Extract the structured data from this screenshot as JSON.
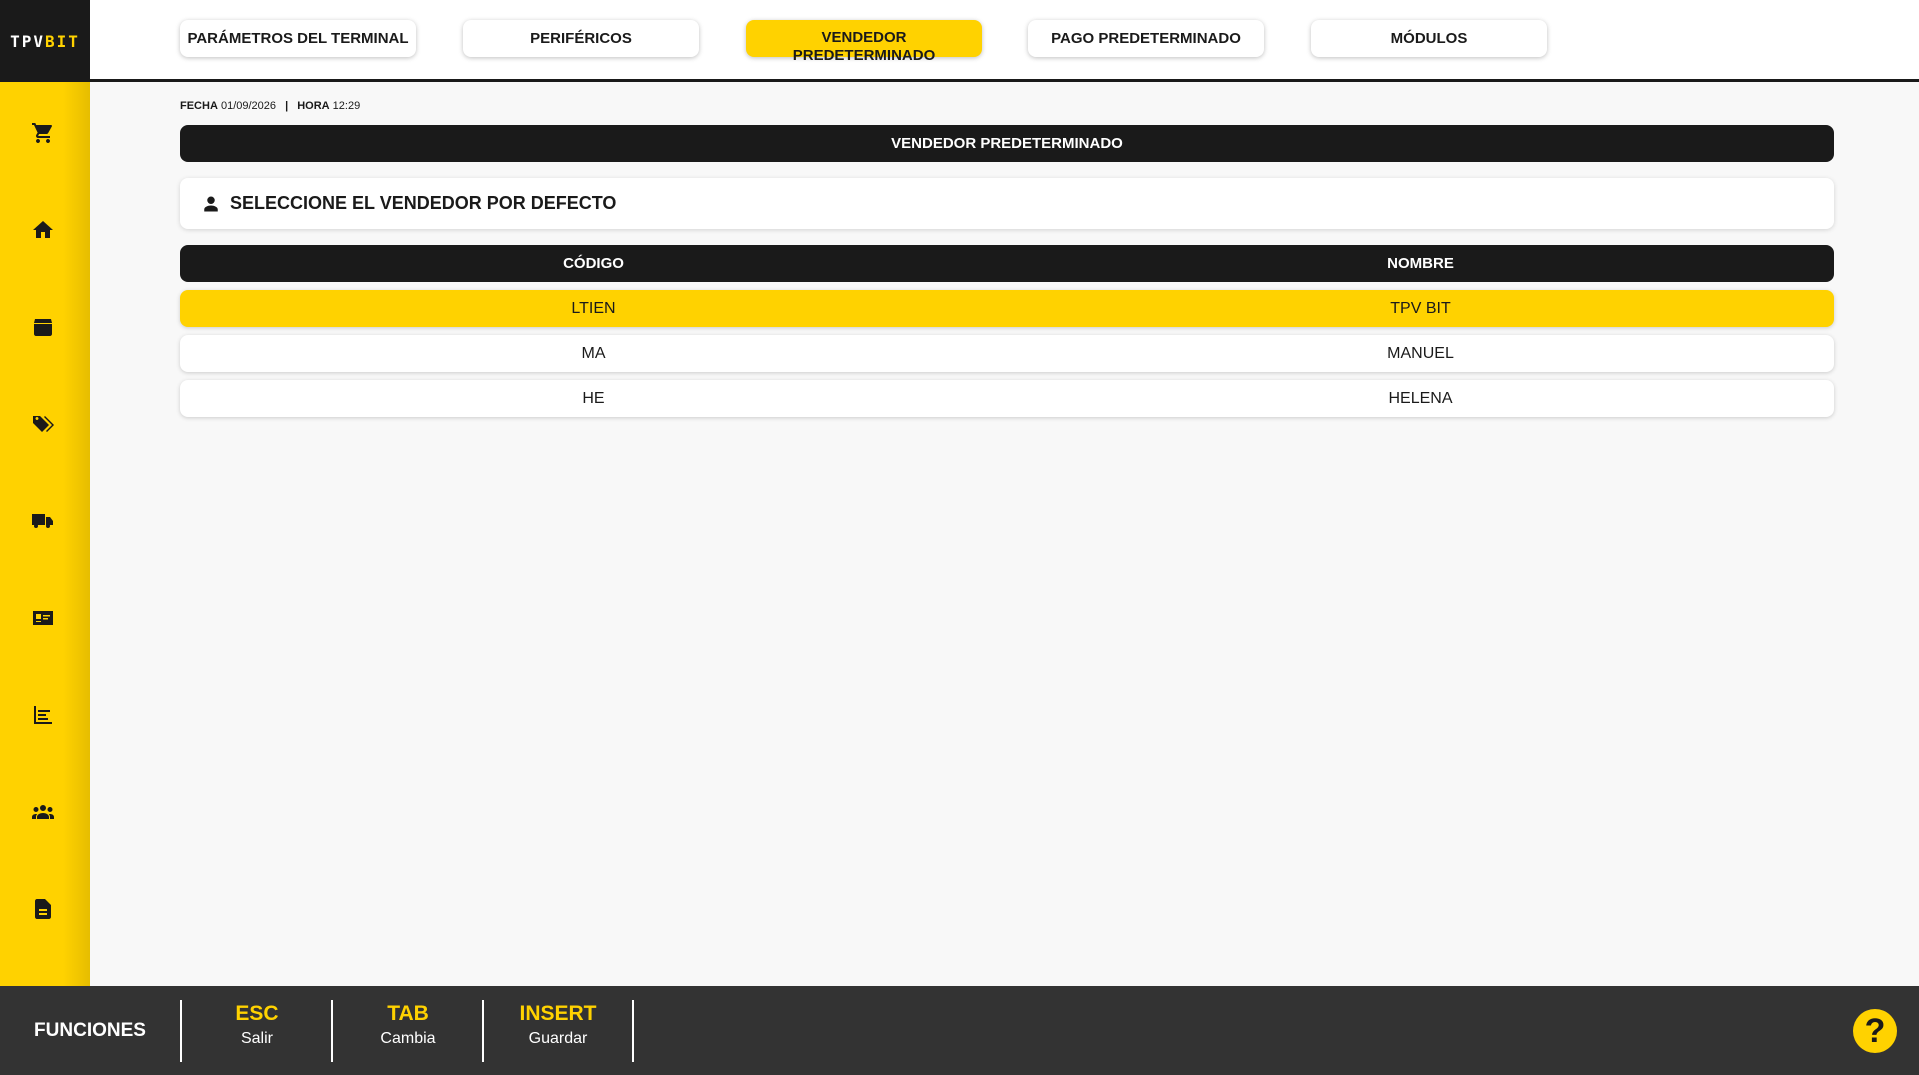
{
  "app": {
    "logo_main": "TPV",
    "logo_accent": "BIT"
  },
  "tabs": [
    {
      "label": "PARÁMETROS DEL TERMINAL",
      "active": false
    },
    {
      "label": "PERIFÉRICOS",
      "active": false
    },
    {
      "label_line1": "VENDEDOR",
      "label_line2": "PREDETERMINADO",
      "active": true
    },
    {
      "label": "PAGO PREDETERMINADO",
      "active": false
    },
    {
      "label": "MÓDULOS",
      "active": false
    }
  ],
  "sidebar": {
    "icons": [
      "cart-icon",
      "home-icon",
      "box-icon",
      "tags-icon",
      "truck-icon",
      "id-card-icon",
      "chart-icon",
      "users-icon",
      "document-icon"
    ]
  },
  "datetime": {
    "fecha_label": "FECHA",
    "fecha_value": "01/09/2026",
    "separator": "|",
    "hora_label": "HORA",
    "hora_value": "12:29"
  },
  "section": {
    "title": "VENDEDOR PREDETERMINADO",
    "select_label": "SELECCIONE EL VENDEDOR POR DEFECTO"
  },
  "table": {
    "headers": [
      "CÓDIGO",
      "NOMBRE"
    ],
    "rows": [
      {
        "codigo": "LTIEN",
        "nombre": "TPV BIT",
        "selected": true
      },
      {
        "codigo": "MA",
        "nombre": "MANUEL",
        "selected": false
      },
      {
        "codigo": "HE",
        "nombre": "HELENA",
        "selected": false
      }
    ]
  },
  "footer": {
    "title": "FUNCIONES",
    "keys": [
      {
        "key": "ESC",
        "action": "Salir"
      },
      {
        "key": "TAB",
        "action": "Cambia"
      },
      {
        "key": "INSERT",
        "action": "Guardar"
      }
    ],
    "help": "?"
  },
  "colors": {
    "accent": "#ffd200",
    "dark": "#1a1a1a",
    "footer": "#333333"
  }
}
